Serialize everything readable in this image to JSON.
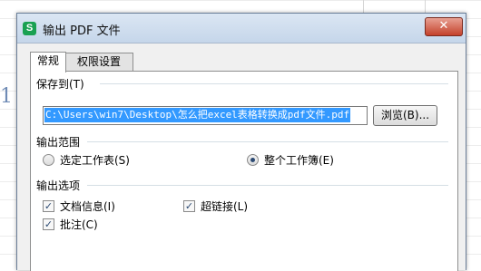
{
  "dialog": {
    "title": "输出 PDF 文件",
    "close_glyph": "✕",
    "app_icon": "S",
    "background_digit": "1"
  },
  "tabs": [
    {
      "label": "常规",
      "active": true
    },
    {
      "label": "权限设置",
      "active": false
    }
  ],
  "save_to": {
    "label": "保存到(T)",
    "path": "C:\\Users\\win7\\Desktop\\怎么把excel表格转换成pdf文件.pdf",
    "browse_label": "浏览(B)..."
  },
  "output_range": {
    "label": "输出范围",
    "options": [
      {
        "label": "选定工作表(S)",
        "selected": false
      },
      {
        "label": "整个工作簿(E)",
        "selected": true
      }
    ]
  },
  "output_options": {
    "label": "输出选项",
    "items": [
      {
        "label": "文档信息(I)",
        "checked": true
      },
      {
        "label": "超链接(L)",
        "checked": true
      },
      {
        "label": "批注(C)",
        "checked": true
      }
    ]
  },
  "icons": {
    "check": "✓"
  }
}
